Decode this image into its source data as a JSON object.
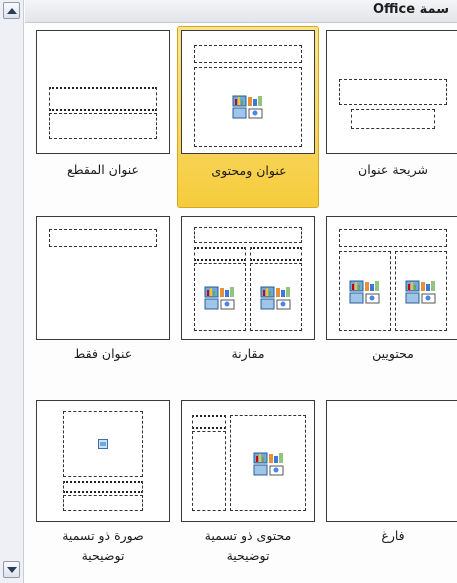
{
  "header": {
    "title": "سمة Office"
  },
  "scrollbar": {
    "up_icon": "triangle-up",
    "down_icon": "triangle-down"
  },
  "layouts": [
    {
      "label": "شريحة عنوان",
      "selected": false,
      "icon": "title-slide"
    },
    {
      "label": "عنوان ومحتوى",
      "selected": true,
      "icon": "title-and-content"
    },
    {
      "label": "عنوان المقطع",
      "selected": false,
      "icon": "section-header"
    },
    {
      "label": "محتويين",
      "selected": false,
      "icon": "two-content"
    },
    {
      "label": "مقارنة",
      "selected": false,
      "icon": "comparison"
    },
    {
      "label": "عنوان فقط",
      "selected": false,
      "icon": "title-only"
    },
    {
      "label": "فارغ",
      "selected": false,
      "icon": "blank"
    },
    {
      "label_line1": "محتوى ذو تسمية",
      "label_line2": "توضيحية",
      "selected": false,
      "icon": "content-with-caption"
    },
    {
      "label_line1": "صورة ذو تسمية",
      "label_line2": "توضيحية",
      "selected": false,
      "icon": "picture-with-caption"
    }
  ]
}
